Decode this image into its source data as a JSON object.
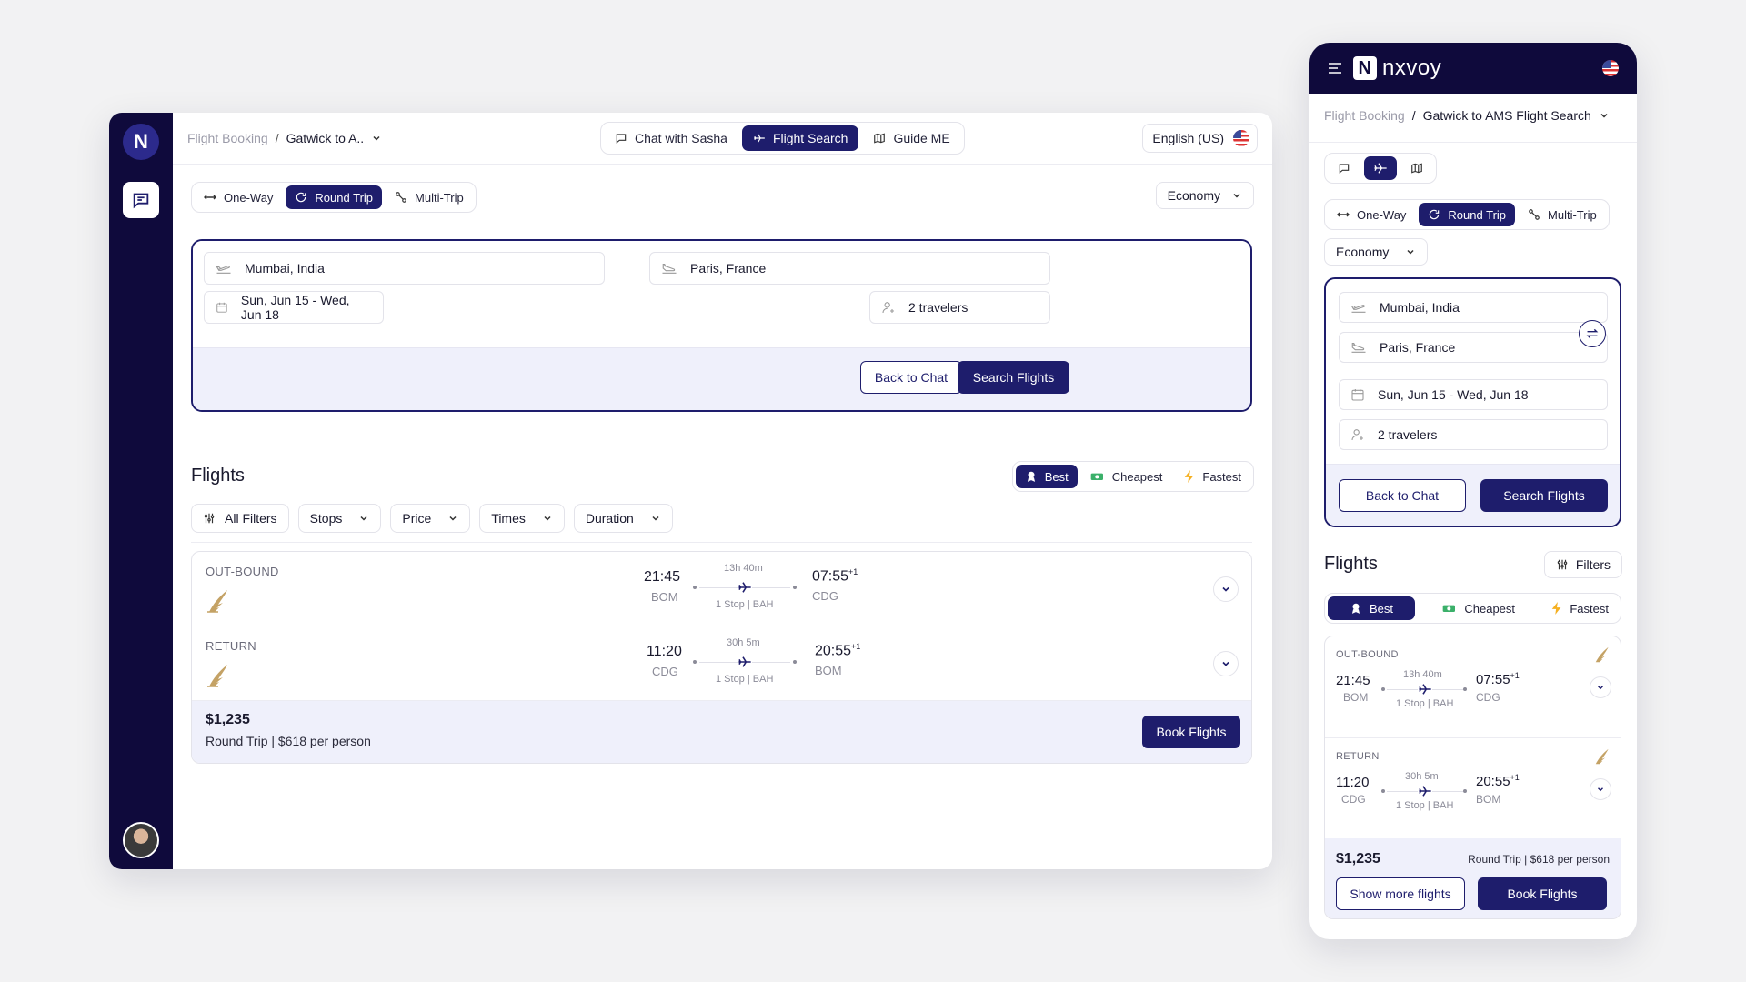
{
  "desktop": {
    "breadcrumb": {
      "root": "Flight Booking",
      "separator": "/",
      "current": "Gatwick to A.."
    },
    "mode_tabs": [
      {
        "label": "Chat with Sasha",
        "icon": "chat-bubble-icon",
        "active": false
      },
      {
        "label": "Flight Search",
        "icon": "plane-icon",
        "active": true
      },
      {
        "label": "Guide ME",
        "icon": "map-icon",
        "active": false
      }
    ],
    "language": "English (US)",
    "trip_types": [
      {
        "label": "One-Way",
        "icon": "arrows-icon",
        "active": false
      },
      {
        "label": "Round Trip",
        "icon": "loop-icon",
        "active": true
      },
      {
        "label": "Multi-Trip",
        "icon": "route-icon",
        "active": false
      }
    ],
    "cabin_class": "Economy",
    "search": {
      "origin": "Mumbai, India",
      "destination": "Paris, France",
      "dates": "Sun, Jun 15 - Wed, Jun 18",
      "travelers": "2 travelers",
      "back_label": "Back to Chat",
      "search_label": "Search Flights"
    },
    "flights_title": "Flights",
    "sort_options": [
      {
        "label": "Best",
        "icon": "medal-icon",
        "active": true
      },
      {
        "label": "Cheapest",
        "icon": "money-icon",
        "active": false
      },
      {
        "label": "Fastest",
        "icon": "bolt-icon",
        "active": false
      }
    ],
    "filters": [
      "All Filters",
      "Stops",
      "Price",
      "Times",
      "Duration"
    ],
    "result": {
      "outbound": {
        "label": "OUT-BOUND",
        "dep_time": "21:45",
        "dep_code": "BOM",
        "duration": "13h 40m",
        "stops": "1 Stop | BAH",
        "arr_time": "07:55",
        "arr_plus": "+1",
        "arr_code": "CDG"
      },
      "return": {
        "label": "RETURN",
        "dep_time": "11:20",
        "dep_code": "CDG",
        "duration": "30h 5m",
        "stops": "1 Stop | BAH",
        "arr_time": "20:55",
        "arr_plus": "+1",
        "arr_code": "BOM"
      },
      "price": "$1,235",
      "price_sub": "Round Trip | $618 per person",
      "book_label": "Book Flights"
    }
  },
  "mobile": {
    "brand": "nxvoy",
    "breadcrumb": {
      "root": "Flight Booking",
      "separator": "/",
      "current": "Gatwick to AMS Flight Search"
    },
    "trip_types": [
      "One-Way",
      "Round Trip",
      "Multi-Trip"
    ],
    "cabin_class": "Economy",
    "search": {
      "origin": "Mumbai, India",
      "destination": "Paris, France",
      "dates": "Sun, Jun 15 - Wed, Jun 18",
      "travelers": "2 travelers",
      "back_label": "Back to Chat",
      "search_label": "Search Flights"
    },
    "flights_title": "Flights",
    "filters_label": "Filters",
    "sort_options": [
      "Best",
      "Cheapest",
      "Fastest"
    ],
    "result": {
      "outbound": {
        "label": "OUT-BOUND",
        "dep_time": "21:45",
        "dep_code": "BOM",
        "duration": "13h 40m",
        "stops": "1 Stop | BAH",
        "arr_time": "07:55",
        "arr_plus": "+1",
        "arr_code": "CDG"
      },
      "return": {
        "label": "RETURN",
        "dep_time": "11:20",
        "dep_code": "CDG",
        "duration": "30h 5m",
        "stops": "1 Stop | BAH",
        "arr_time": "20:55",
        "arr_plus": "+1",
        "arr_code": "BOM"
      },
      "price": "$1,235",
      "price_sub": "Round Trip | $618 per person",
      "more_label": "Show more flights",
      "book_label": "Book Flights"
    }
  },
  "colors": {
    "navy": "#1e1d6c",
    "rail": "#0f0a3c",
    "tint": "#eff0fb",
    "gold": "#c4a265"
  }
}
